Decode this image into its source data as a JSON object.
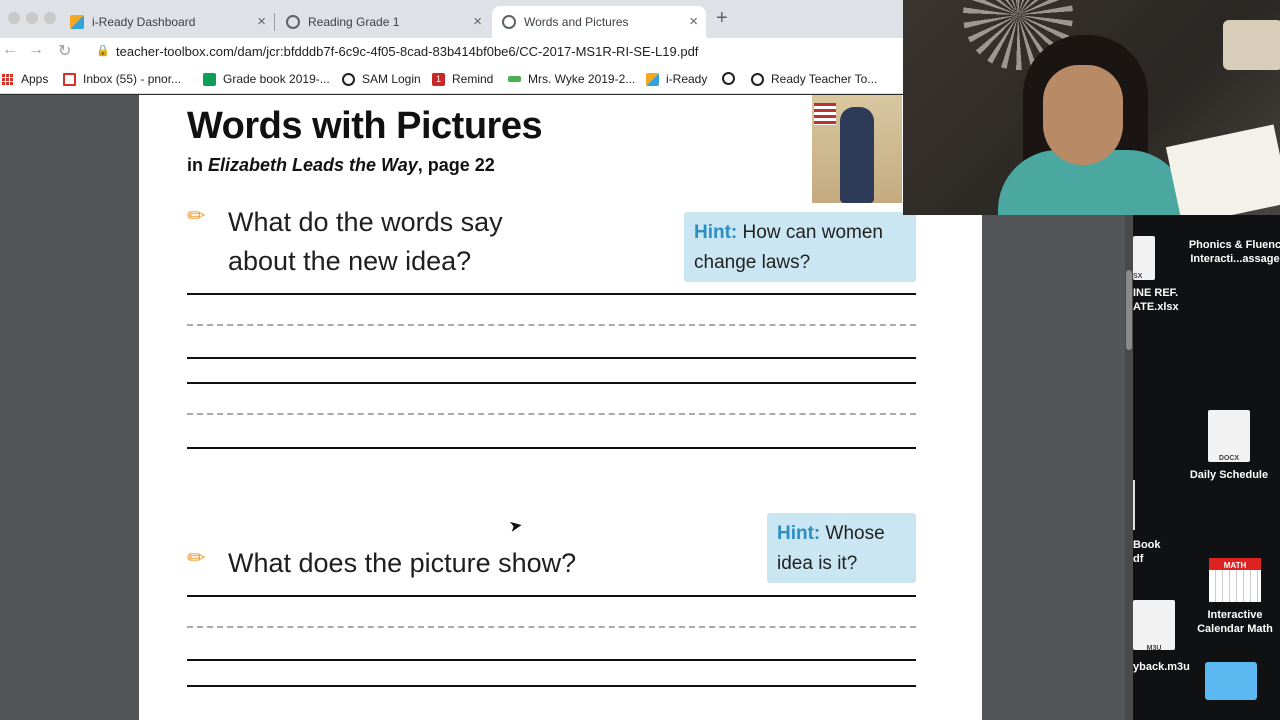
{
  "browser": {
    "tabs": [
      {
        "label": "i-Ready Dashboard"
      },
      {
        "label": "Reading Grade 1"
      },
      {
        "label": "Words and Pictures"
      }
    ],
    "url": "teacher-toolbox.com/dam/jcr:bfdddb7f-6c9c-4f05-8cad-83b414bf0be6/CC-2017-MS1R-RI-SE-L19.pdf",
    "bookmarks": [
      {
        "label": "Apps"
      },
      {
        "label": "Inbox (55) - pnor..."
      },
      {
        "label": "Grade book 2019-..."
      },
      {
        "label": "SAM Login"
      },
      {
        "label": "Remind"
      },
      {
        "label": "Mrs. Wyke 2019-2..."
      },
      {
        "label": "i-Ready"
      },
      {
        "label": ""
      },
      {
        "label": "Ready Teacher To..."
      }
    ],
    "remind_badge": "1"
  },
  "document": {
    "title": "Words with Pictures",
    "subtitle_prefix": "in ",
    "subtitle_book": "Elizabeth Leads the Way",
    "subtitle_suffix": ", page 22",
    "questions": [
      {
        "line1": "What do the words say",
        "line2": "about the new idea?",
        "hint_label": "Hint:",
        "hint_line1": " How can women",
        "hint_line2": "change laws?"
      },
      {
        "line1": "What does the picture show?",
        "hint_label": "Hint:",
        "hint_line1": " Whose",
        "hint_line2": "idea is it?"
      }
    ]
  },
  "desktop": {
    "items": [
      {
        "label1": "Phonics & Fluenc",
        "label2": "Interacti...assage"
      },
      {
        "label1": "INE REF.",
        "label2": "ATE.xlsx",
        "badge": "SX"
      },
      {
        "label1": "Daily Schedule",
        "badge": "DOCX"
      },
      {
        "label1": "Book",
        "label2": "df"
      },
      {
        "label1": "Interactive",
        "label2": "Calendar Math",
        "badge": "MATH"
      },
      {
        "label1": "yback.m3u",
        "badge": "M3U"
      }
    ]
  },
  "colors": {
    "hint_bg": "#c9e6f2",
    "hint_label": "#2c8fc4",
    "pencil": "#f39a2c"
  }
}
